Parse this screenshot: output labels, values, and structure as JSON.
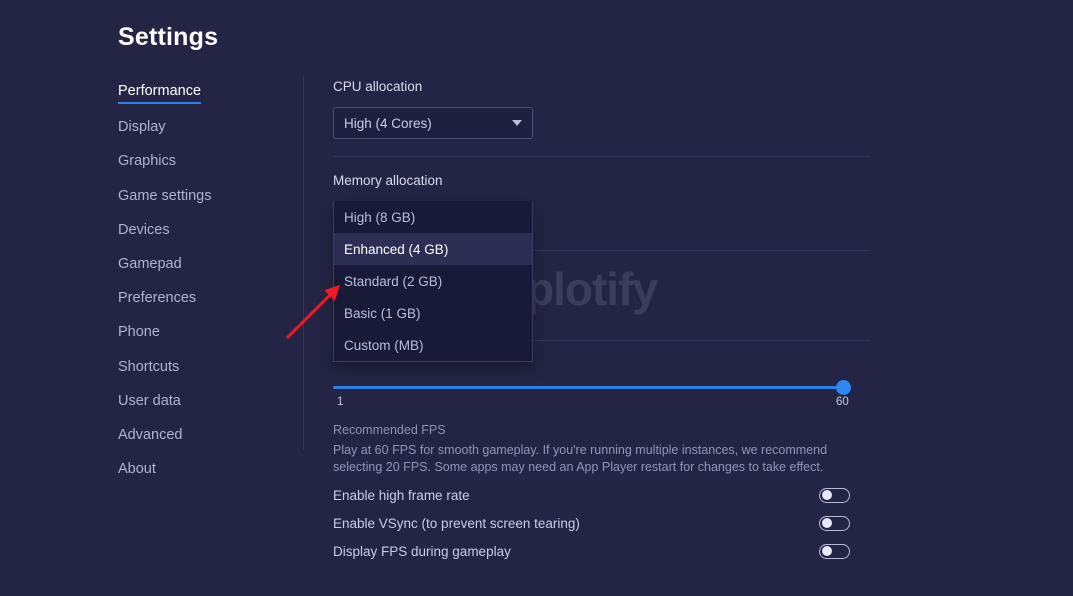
{
  "window": {
    "background": "#242544",
    "accent": "#2f7fe8"
  },
  "header": {
    "title": "Settings"
  },
  "watermark": {
    "text": "plotify"
  },
  "sidebar": {
    "items": [
      {
        "label": "Performance",
        "active": true
      },
      {
        "label": "Display",
        "active": false
      },
      {
        "label": "Graphics",
        "active": false
      },
      {
        "label": "Game settings",
        "active": false
      },
      {
        "label": "Devices",
        "active": false
      },
      {
        "label": "Gamepad",
        "active": false
      },
      {
        "label": "Preferences",
        "active": false
      },
      {
        "label": "Phone",
        "active": false
      },
      {
        "label": "Shortcuts",
        "active": false
      },
      {
        "label": "User data",
        "active": false
      },
      {
        "label": "Advanced",
        "active": false
      },
      {
        "label": "About",
        "active": false
      }
    ]
  },
  "main": {
    "cpu": {
      "label": "CPU allocation",
      "value": "High (4 Cores)"
    },
    "memory": {
      "label": "Memory allocation",
      "value": "Enhanced (4 GB)",
      "open": true,
      "options": [
        {
          "label": "High (8 GB)",
          "selected": false
        },
        {
          "label": "Enhanced (4 GB)",
          "selected": true
        },
        {
          "label": "Standard (2 GB)",
          "selected": false
        },
        {
          "label": "Basic (1 GB)",
          "selected": false
        },
        {
          "label": "Custom (MB)",
          "selected": false
        }
      ]
    },
    "fps": {
      "min_label": "1",
      "max_label": "60",
      "value": 60,
      "min": 1,
      "max": 60,
      "recommended_title": "Recommended FPS",
      "recommended_desc": "Play at 60 FPS for smooth gameplay. If you're running multiple instances, we recommend selecting 20 FPS. Some apps may need an App Player restart for changes to take effect."
    },
    "toggles": [
      {
        "label": "Enable high frame rate",
        "on": false
      },
      {
        "label": "Enable VSync (to prevent screen tearing)",
        "on": false
      },
      {
        "label": "Display FPS during gameplay",
        "on": false
      }
    ]
  }
}
